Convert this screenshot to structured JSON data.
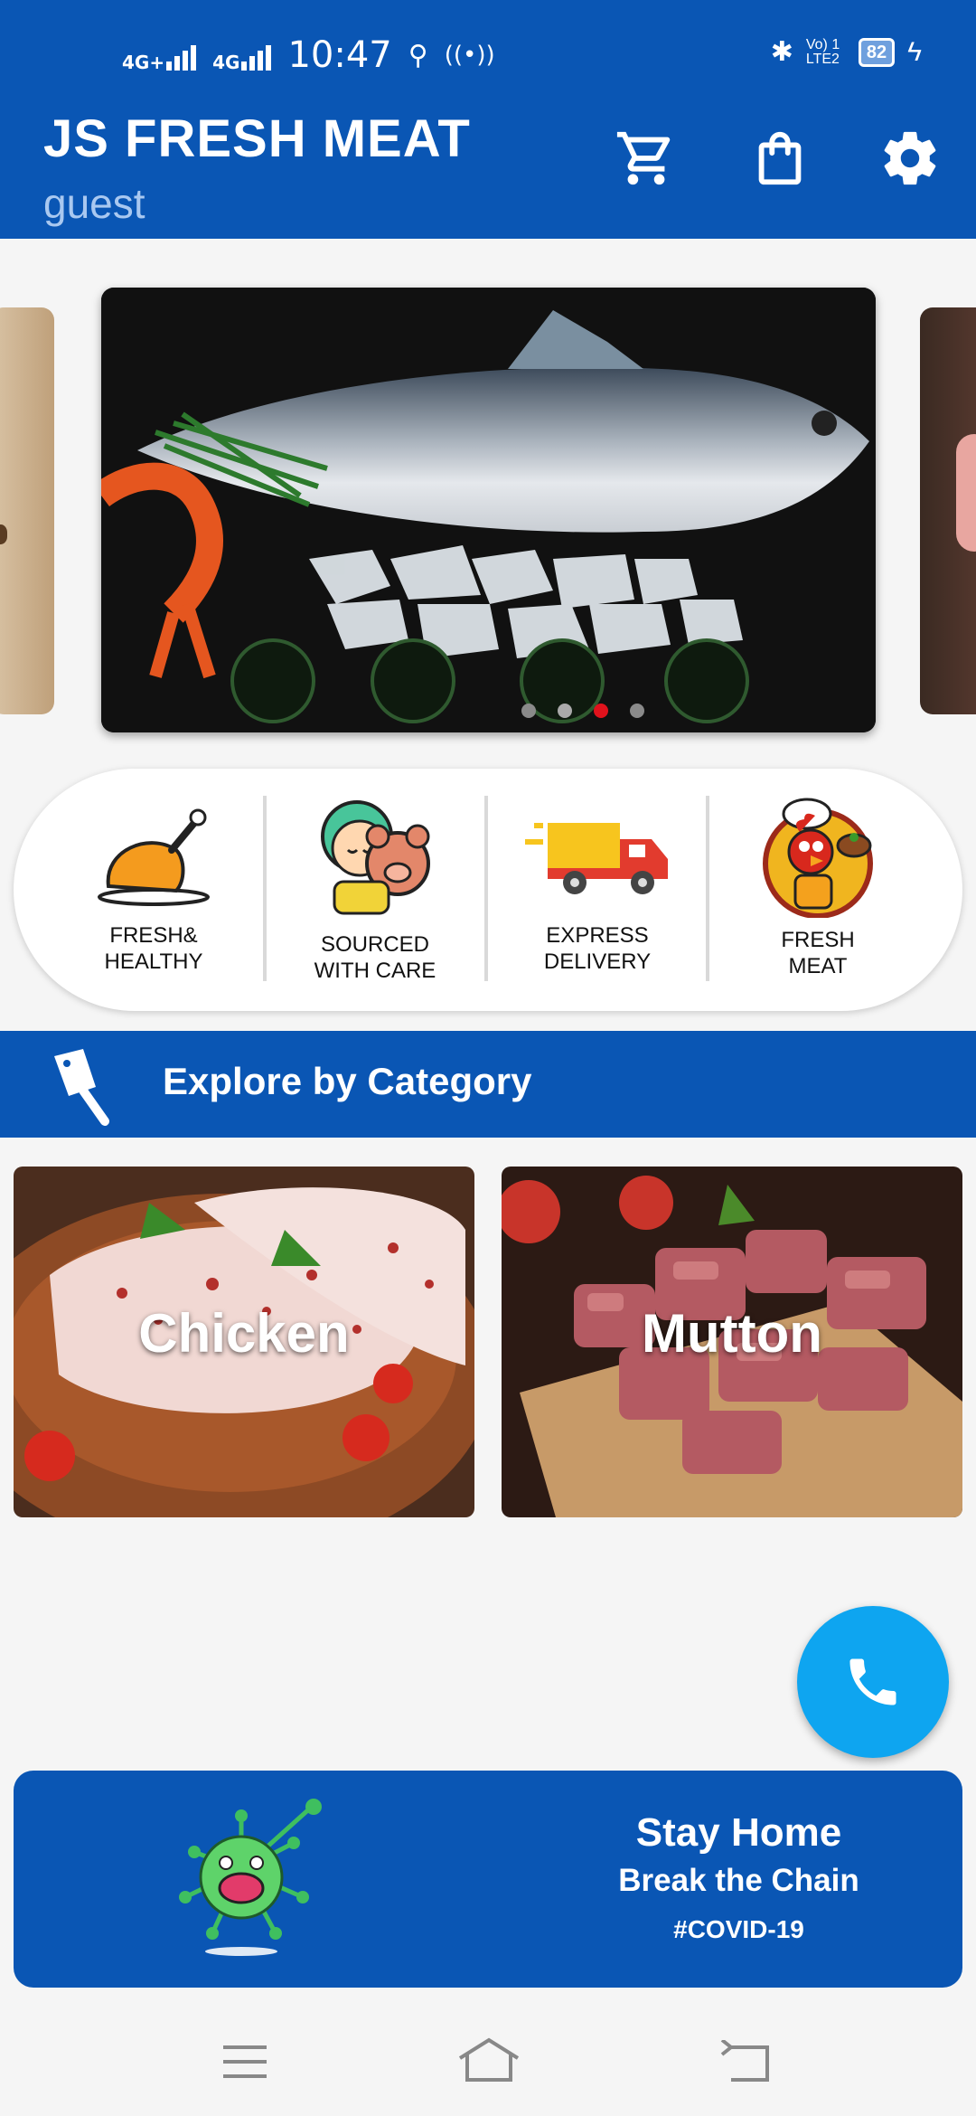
{
  "status_bar": {
    "network1": "4G+",
    "network2": "4G",
    "time": "10:47",
    "volte": "Vo) 1 LTE2",
    "battery": "82"
  },
  "app_bar": {
    "title": "JS FRESH MEAT",
    "subtitle": "guest"
  },
  "features": [
    {
      "label": "FRESH&\nHEALTHY",
      "icon": "roast-chicken-icon"
    },
    {
      "label": "SOURCED\nWITH CARE",
      "icon": "girl-hugging-pig-icon"
    },
    {
      "label": "EXPRESS\nDELIVERY",
      "icon": "delivery-truck-icon"
    },
    {
      "label": "FRESH\nMEAT",
      "icon": "chef-rooster-icon"
    }
  ],
  "carousel": {
    "dot_count": 4,
    "active_index": 2
  },
  "category_section": {
    "title": "Explore by Category"
  },
  "categories": [
    {
      "name": "Chicken"
    },
    {
      "name": "Mutton"
    }
  ],
  "covid_banner": {
    "line1": "Stay Home",
    "line2": "Break the Chain",
    "line3": "#COVID-19"
  },
  "colors": {
    "primary": "#0a56b4",
    "fab": "#0ea5f0",
    "active_dot": "#e0121c"
  }
}
